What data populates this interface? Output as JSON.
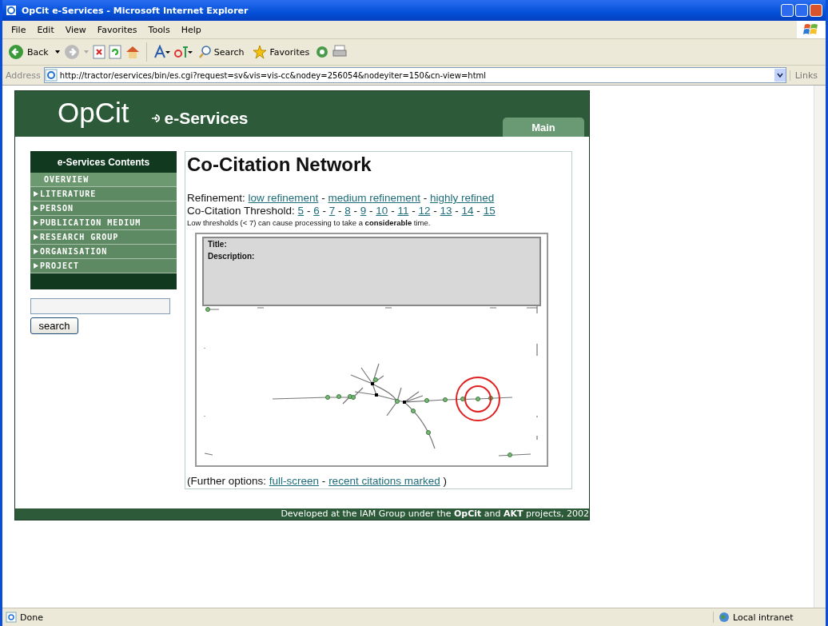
{
  "window": {
    "title": "OpCit e-Services - Microsoft Internet Explorer"
  },
  "menu": [
    "File",
    "Edit",
    "View",
    "Favorites",
    "Tools",
    "Help"
  ],
  "toolbar": {
    "back": "Back",
    "search": "Search",
    "favorites": "Favorites"
  },
  "address": {
    "label": "Address",
    "url": "http://tractor/eservices/bin/es.cgi?request=sv&vis=vis-cc&nodey=256054&nodeyiter=150&cn-view=html",
    "links": "Links"
  },
  "page": {
    "logo": "OpCit",
    "subtitle": "e-Services",
    "tabs": [
      {
        "label": "Main",
        "selected": true
      }
    ],
    "sidebar": {
      "title": "e-Services Contents",
      "items": [
        {
          "label": "OVERVIEW",
          "expandable": false
        },
        {
          "label": "LITERATURE",
          "expandable": true
        },
        {
          "label": "PERSON",
          "expandable": true
        },
        {
          "label": "PUBLICATION MEDIUM",
          "expandable": true
        },
        {
          "label": "RESEARCH GROUP",
          "expandable": true
        },
        {
          "label": "ORGANISATION",
          "expandable": true
        },
        {
          "label": "PROJECT",
          "expandable": true
        }
      ],
      "search_button": "search"
    },
    "heading": "Co-Citation Network",
    "refinement": {
      "label": "Refinement:",
      "links": [
        {
          "label": "low refinement",
          "suffix": "-"
        },
        {
          "label": "medium refinement",
          "suffix": "-"
        },
        {
          "label": "highly refined"
        }
      ]
    },
    "threshold": {
      "label": "Co-Citation Threshold:",
      "links": [
        {
          "label": "5",
          "suffix": "-"
        },
        {
          "label": "6",
          "suffix": "-"
        },
        {
          "label": "7",
          "suffix": "-"
        },
        {
          "label": "8",
          "suffix": "-"
        },
        {
          "label": "9",
          "suffix": "-"
        },
        {
          "label": "10",
          "suffix": "-"
        },
        {
          "label": "11",
          "suffix": "-"
        },
        {
          "label": "12",
          "suffix": "-"
        },
        {
          "label": "13",
          "suffix": "-"
        },
        {
          "label": "14",
          "suffix": "-"
        },
        {
          "label": "15"
        }
      ]
    },
    "note": "Low thresholds (< 7) can cause processing to take a **considerable** time.",
    "info": {
      "title_label": "Title:",
      "description_label": "Description:"
    },
    "further": {
      "prefix": "(Further options:",
      "links": [
        {
          "label": "full-screen",
          "suffix": "-"
        },
        {
          "label": "recent citations marked"
        }
      ],
      "suffix": ")"
    },
    "footer": "Developed at the IAM Group under the **OpCit** and **AKT** projects, 2002"
  },
  "status_bar": {
    "status": "Done",
    "zone": "Local intranet"
  }
}
